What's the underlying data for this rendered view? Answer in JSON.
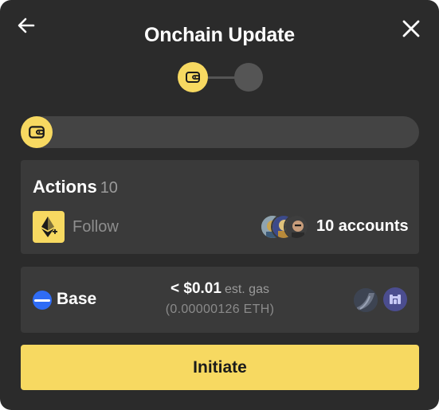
{
  "header": {
    "title": "Onchain Update",
    "back_icon": "arrow-left-icon",
    "close_icon": "close-icon"
  },
  "stepper": {
    "current_step": 1,
    "total_steps": 2,
    "step_icon": "wallet-icon"
  },
  "progress": {
    "icon": "wallet-icon"
  },
  "actions": {
    "title": "Actions",
    "count": "10",
    "action_label": "Follow",
    "action_icon": "ethereum-plus-icon",
    "accounts_label": "10 accounts"
  },
  "network": {
    "chain_name": "Base",
    "gas_price": "< $0.01",
    "gas_suffix": "est. gas",
    "gas_eth": "(0.00000126 ETH)"
  },
  "cta": {
    "label": "Initiate"
  },
  "colors": {
    "modal_bg": "#2b2b2b",
    "card_bg": "#3a3a3a",
    "accent": "#f7d961",
    "chain_blue": "#2f6cf5"
  }
}
